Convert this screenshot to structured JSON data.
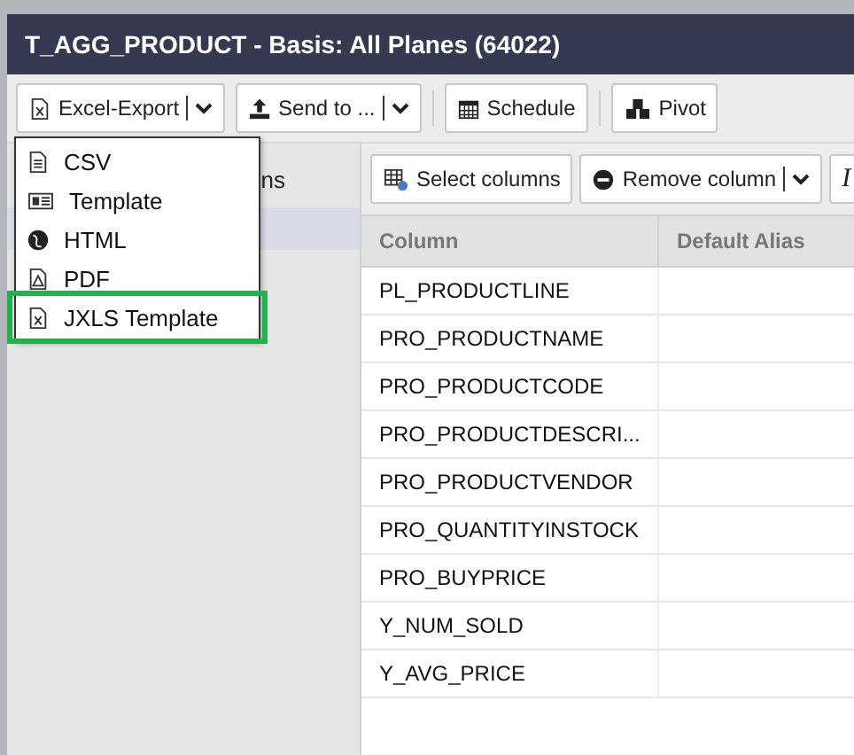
{
  "window": {
    "title": "T_AGG_PRODUCT - Basis: All Planes (64022)"
  },
  "toolbar": [
    {
      "label": "Excel-Export",
      "kind": "split"
    },
    {
      "label": "Send to ...",
      "kind": "split"
    },
    {
      "label": "Schedule",
      "kind": "plain"
    },
    {
      "label": "Pivot",
      "kind": "plain"
    }
  ],
  "export_menu": [
    {
      "label": "CSV",
      "selected": false
    },
    {
      "label": "Template",
      "selected": false
    },
    {
      "label": "HTML",
      "selected": false
    },
    {
      "label": "PDF",
      "selected": false
    },
    {
      "label": "JXLS Template",
      "selected": true
    }
  ],
  "sidebar": {
    "items": [
      {
        "label": "ns",
        "selected": false
      },
      {
        "selected": true
      }
    ]
  },
  "table_toolbar": [
    {
      "label": "Select columns",
      "kind": "plain"
    },
    {
      "label": "Remove column",
      "kind": "split"
    },
    {
      "label": "I",
      "kind": "italic"
    }
  ],
  "table": {
    "columns": [
      "Column",
      "Default Alias"
    ],
    "rows": [
      "PL_PRODUCTLINE",
      "PRO_PRODUCTNAME",
      "PRO_PRODUCTCODE",
      "PRO_PRODUCTDESCRI...",
      "PRO_PRODUCTVENDOR",
      "PRO_QUANTITYINSTOCK",
      "PRO_BUYPRICE",
      "Y_NUM_SOLD",
      "Y_AVG_PRICE"
    ]
  }
}
